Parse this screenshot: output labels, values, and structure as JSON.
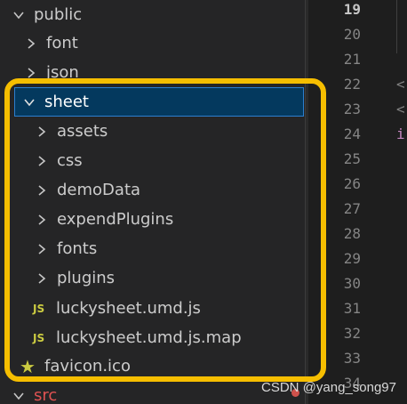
{
  "explorer": {
    "public": "public",
    "font": "font",
    "json": "json",
    "sheet": "sheet",
    "sheet_children": [
      "assets",
      "css",
      "demoData",
      "expendPlugins",
      "fonts",
      "plugins"
    ],
    "js_badge": "JS",
    "file1": "luckysheet.umd.js",
    "file2": "luckysheet.umd.js.map",
    "favicon": "favicon.ico",
    "src": "src"
  },
  "gutter": {
    "line_numbers": [
      "19",
      "20",
      "21",
      "22",
      "23",
      "24",
      "25",
      "26",
      "27",
      "28",
      "29",
      "30",
      "31",
      "32",
      "33",
      "34"
    ],
    "active_line": "19"
  },
  "code": {
    "ch1": "<",
    "ch2": "<",
    "ch3": "i"
  },
  "watermark": "CSDN @yang_song97",
  "colors": {
    "highlight": "#f6be00",
    "selection": "#04395e",
    "js_icon": "#cbcb41",
    "error": "#d0524c"
  }
}
